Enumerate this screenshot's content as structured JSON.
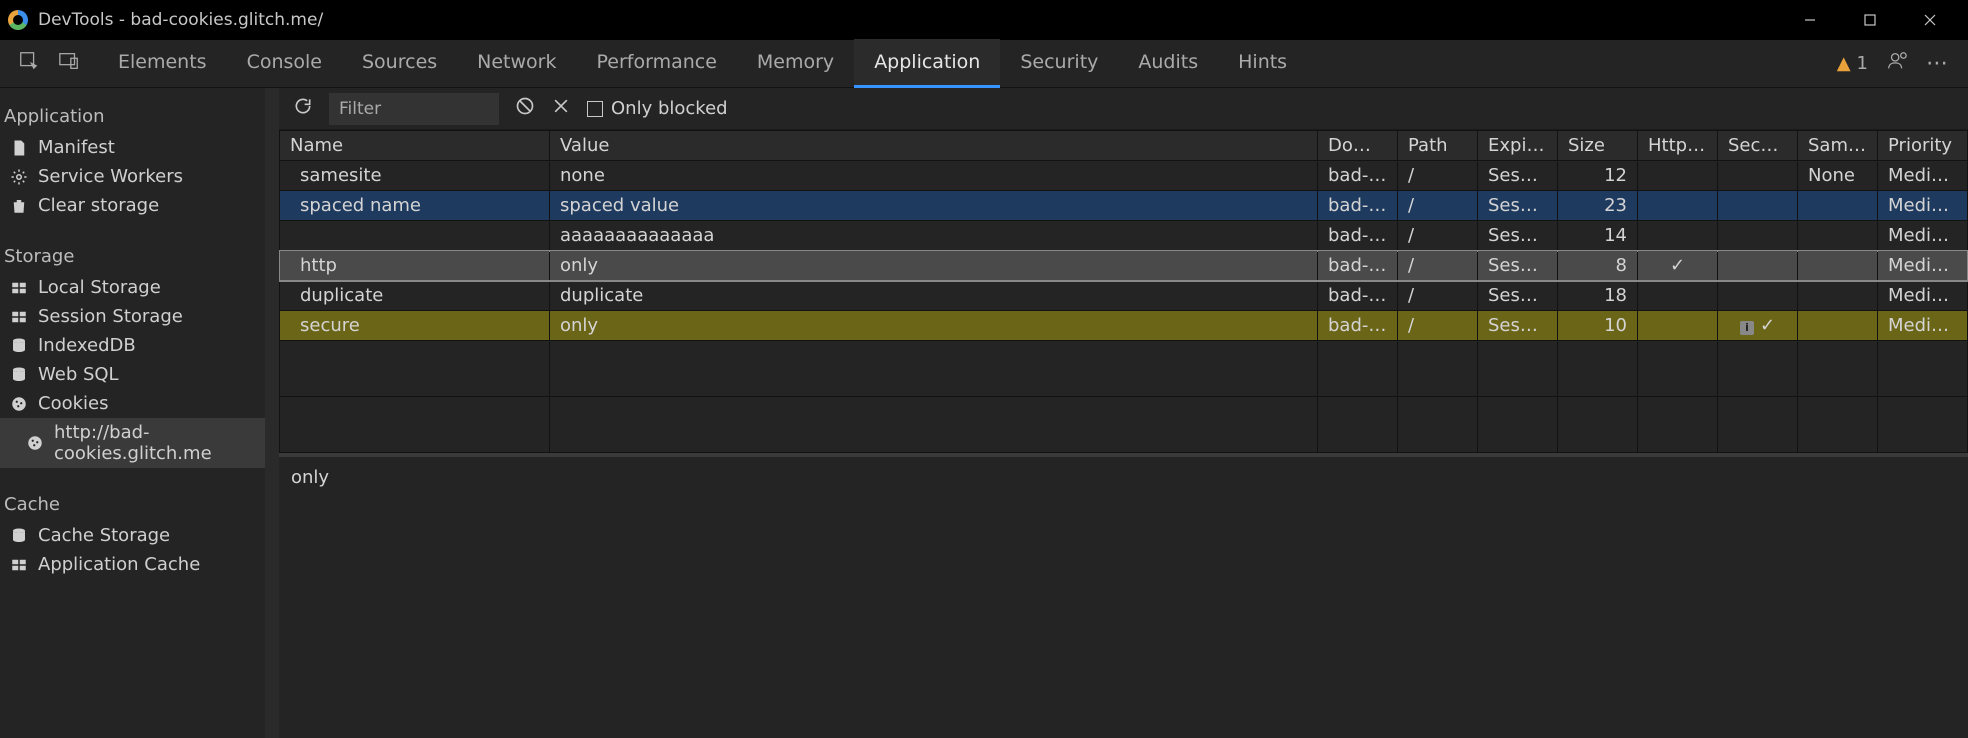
{
  "window": {
    "title": "DevTools - bad-cookies.glitch.me/"
  },
  "tabs": {
    "items": [
      "Elements",
      "Console",
      "Sources",
      "Network",
      "Performance",
      "Memory",
      "Application",
      "Security",
      "Audits",
      "Hints"
    ],
    "active": "Application",
    "warning_count": "1"
  },
  "sidebar": {
    "sections": [
      {
        "header": "Application",
        "items": [
          {
            "icon": "document-icon",
            "label": "Manifest"
          },
          {
            "icon": "gear-icon",
            "label": "Service Workers"
          },
          {
            "icon": "trash-icon",
            "label": "Clear storage"
          }
        ]
      },
      {
        "header": "Storage",
        "items": [
          {
            "icon": "grid-icon",
            "label": "Local Storage"
          },
          {
            "icon": "grid-icon",
            "label": "Session Storage"
          },
          {
            "icon": "database-icon",
            "label": "IndexedDB"
          },
          {
            "icon": "database-icon",
            "label": "Web SQL"
          },
          {
            "icon": "cookie-icon",
            "label": "Cookies"
          },
          {
            "icon": "cookie-icon",
            "label": "http://bad-cookies.glitch.me",
            "sub": true,
            "selected": true
          }
        ]
      },
      {
        "header": "Cache",
        "items": [
          {
            "icon": "database-icon",
            "label": "Cache Storage"
          },
          {
            "icon": "grid-icon",
            "label": "Application Cache"
          }
        ]
      }
    ]
  },
  "toolbar": {
    "filter_placeholder": "Filter",
    "only_blocked_label": "Only blocked"
  },
  "columns": [
    "Name",
    "Value",
    "Domain",
    "Path",
    "Expires...",
    "Size",
    "HttpO...",
    "Secure",
    "SameS...",
    "Priority"
  ],
  "rows": [
    {
      "name": "samesite",
      "value": "none",
      "domain": "bad-co...",
      "path": "/",
      "expires": "Session",
      "size": "12",
      "httponly": "",
      "secure": "",
      "samesite": "None",
      "priority": "Medium",
      "state": ""
    },
    {
      "name": "spaced name",
      "value": "spaced value",
      "domain": "bad-co...",
      "path": "/",
      "expires": "Session",
      "size": "23",
      "httponly": "",
      "secure": "",
      "samesite": "",
      "priority": "Medium",
      "state": "sel-blue"
    },
    {
      "name": "",
      "value": "aaaaaaaaaaaaaa",
      "domain": "bad-co...",
      "path": "/",
      "expires": "Session",
      "size": "14",
      "httponly": "",
      "secure": "",
      "samesite": "",
      "priority": "Medium",
      "state": ""
    },
    {
      "name": "http",
      "value": "only",
      "domain": "bad-co...",
      "path": "/",
      "expires": "Session",
      "size": "8",
      "httponly": "✓",
      "secure": "",
      "samesite": "",
      "priority": "Medium",
      "state": "sel-grey"
    },
    {
      "name": "duplicate",
      "value": "duplicate",
      "domain": "bad-co...",
      "path": "/",
      "expires": "Session",
      "size": "18",
      "httponly": "",
      "secure": "",
      "samesite": "",
      "priority": "Medium",
      "state": ""
    },
    {
      "name": "secure",
      "value": "only",
      "domain": "bad-co...",
      "path": "/",
      "expires": "Session",
      "size": "10",
      "httponly": "",
      "secure": "info-check",
      "samesite": "",
      "priority": "Medium",
      "state": "sel-yellow"
    }
  ],
  "detail": {
    "value": "only"
  }
}
